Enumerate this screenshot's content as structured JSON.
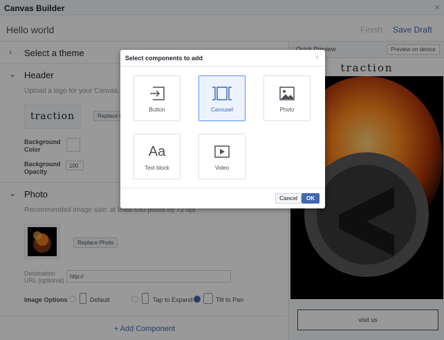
{
  "window": {
    "title": "Canvas Builder",
    "close": "×"
  },
  "toolbar": {
    "name": "Hello world",
    "finish_label": "Finish",
    "save_label": "Save Draft"
  },
  "sections": {
    "theme": {
      "label": "Select a theme",
      "chevron": "›"
    },
    "header": {
      "label": "Header",
      "chevron": "⌄",
      "hint": "Upload a logo for your Canvas. For best res",
      "logo_text": "traction",
      "replace_label": "Replace P",
      "bg_color_label": "Background Color",
      "bg_opacity_label": "Background Opacity",
      "bg_opacity_value": "100"
    },
    "photo": {
      "label": "Photo",
      "chevron": "⌄",
      "hint": "Recommended image size: at least 640 pixels by 72 dpi",
      "replace_label": "Replace Photo",
      "dest_label": "Destination URL (optional)",
      "dest_value": "http://",
      "options_label": "Image Options",
      "options": [
        {
          "label": "Default",
          "selected": false
        },
        {
          "label": "Tap to Expand",
          "selected": false
        },
        {
          "label": "Tilt to Pan",
          "selected": true
        }
      ]
    }
  },
  "add_component_label": "+ Add Component",
  "preview": {
    "label": "Quick Preview",
    "button_label": "Preview on device",
    "logo_text": "traction",
    "visit_label": "visit us"
  },
  "modal": {
    "title": "Select components to add",
    "close": "×",
    "components": [
      {
        "label": "Button",
        "icon": "button-icon",
        "selected": false
      },
      {
        "label": "Carousel",
        "icon": "carousel-icon",
        "selected": true
      },
      {
        "label": "Photo",
        "icon": "photo-icon",
        "selected": false
      },
      {
        "label": "Text block",
        "icon": "text-block-icon",
        "selected": false
      },
      {
        "label": "Video",
        "icon": "video-icon",
        "selected": false
      }
    ],
    "cancel_label": "Cancel",
    "ok_label": "OK"
  },
  "colors": {
    "accent": "#4267b2",
    "selected_border": "#5890ff",
    "selected_bg": "#ecf3ff"
  }
}
